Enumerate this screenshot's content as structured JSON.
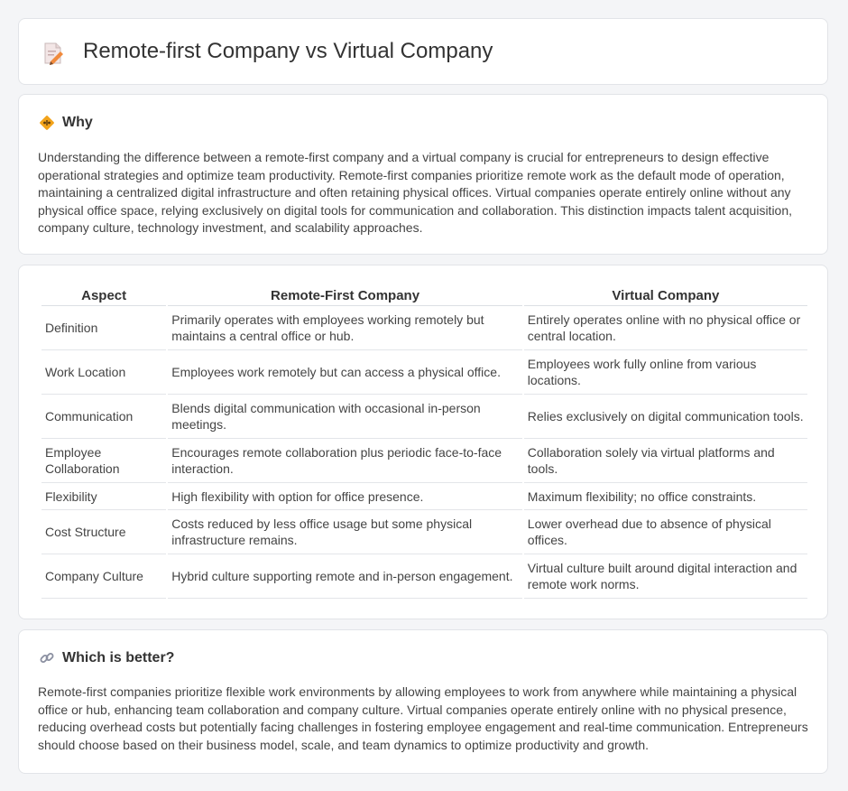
{
  "header": {
    "title": "Remote-first Company vs Virtual Company",
    "icon": "document-pencil-icon"
  },
  "why": {
    "icon": "diamond-sign-icon",
    "title": "Why",
    "text": "Understanding the difference between a remote-first company and a virtual company is crucial for entrepreneurs to design effective operational strategies and optimize team productivity. Remote-first companies prioritize remote work as the default mode of operation, maintaining a centralized digital infrastructure and often retaining physical offices. Virtual companies operate entirely online without any physical office space, relying exclusively on digital tools for communication and collaboration. This distinction impacts talent acquisition, company culture, technology investment, and scalability approaches."
  },
  "table": {
    "headers": [
      "Aspect",
      "Remote-First Company",
      "Virtual Company"
    ],
    "rows": [
      [
        "Definition",
        "Primarily operates with employees working remotely but maintains a central office or hub.",
        "Entirely operates online with no physical office or central location."
      ],
      [
        "Work Location",
        "Employees work remotely but can access a physical office.",
        "Employees work fully online from various locations."
      ],
      [
        "Communication",
        "Blends digital communication with occasional in-person meetings.",
        "Relies exclusively on digital communication tools."
      ],
      [
        "Employee Collaboration",
        "Encourages remote collaboration plus periodic face-to-face interaction.",
        "Collaboration solely via virtual platforms and tools."
      ],
      [
        "Flexibility",
        "High flexibility with option for office presence.",
        "Maximum flexibility; no office constraints."
      ],
      [
        "Cost Structure",
        "Costs reduced by less office usage but some physical infrastructure remains.",
        "Lower overhead due to absence of physical offices."
      ],
      [
        "Company Culture",
        "Hybrid culture supporting remote and in-person engagement.",
        "Virtual culture built around digital interaction and remote work norms."
      ]
    ]
  },
  "better": {
    "icon": "link-icon",
    "title": "Which is better?",
    "text": "Remote-first companies prioritize flexible work environments by allowing employees to work from anywhere while maintaining a physical office or hub, enhancing team collaboration and company culture. Virtual companies operate entirely online with no physical presence, reducing overhead costs but potentially facing challenges in fostering employee engagement and real-time communication. Entrepreneurs should choose based on their business model, scale, and team dynamics to optimize productivity and growth."
  }
}
